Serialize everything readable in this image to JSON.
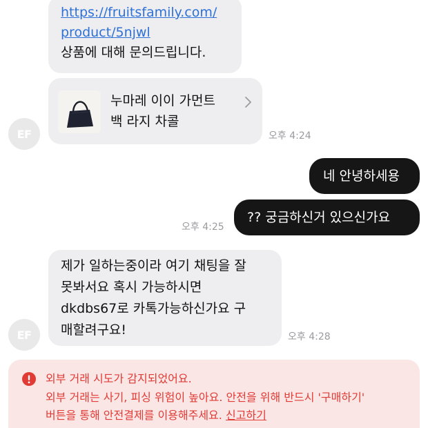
{
  "messages": {
    "first": {
      "link": "https://fruitsfamily.com/product/5njwl",
      "link_line1": "https://fruitsfamily.com/",
      "link_line2": "product/5njwl",
      "text": "상품에 대해 문의드립니다."
    },
    "product": {
      "name_line1": "누마레 이이 가먼트",
      "name_line2": "백 라지 차콜",
      "thumbnail_icon": "tote-bag-icon"
    },
    "time_1": "오후 4:24",
    "reply_1": "네 안녕하세용",
    "reply_2": "?? 궁금하신거 있으신가요",
    "time_2": "오후 4:25",
    "incoming_2": {
      "line1": "제가 일하는중이라 여기 채팅을 잘",
      "line2": "못봐서요 혹시 가능하시면",
      "line3": "dkdbs67로 카톡가능하신가요 구",
      "line4": "매할려구요!"
    },
    "time_3": "오후 4:28"
  },
  "avatar": {
    "initials": "EF"
  },
  "warning": {
    "line1": "외부 거래 시도가 감지되었어요.",
    "line2": "외부 거래는 사기, 피싱 위험이 높아요. 안전을 위해 반드시 '구매하기'",
    "line3": "버튼을 통해 안전결제를 이용해주세요.",
    "report_link": "신고하기",
    "icon": "alert-circle-icon"
  },
  "colors": {
    "incoming_bubble": "#eeeef0",
    "outgoing_bubble": "#161616",
    "link": "#2e71d6",
    "warning_bg": "#fbe6e6",
    "warning_text": "#e03b35",
    "timestamp": "#9a9a9f",
    "avatar_bg": "#e9e9ea"
  }
}
